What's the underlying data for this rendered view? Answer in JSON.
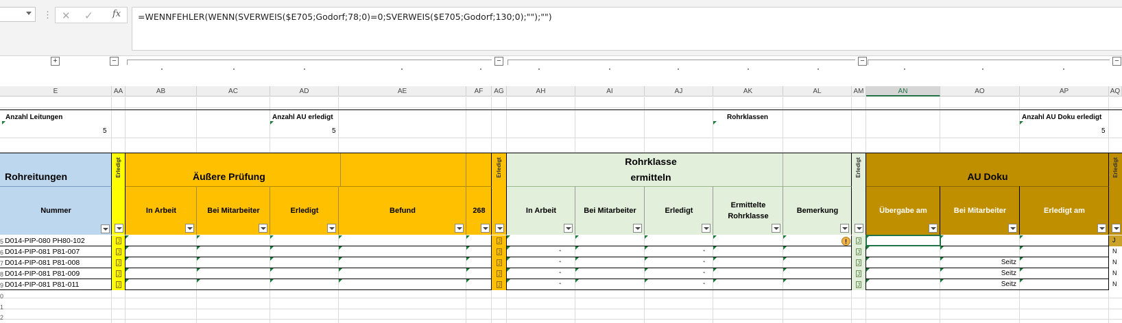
{
  "formula_bar": {
    "name_box": "",
    "cancel_icon": "x-icon",
    "enter_icon": "check-icon",
    "fx_label": "fx",
    "formula": "=WENNFEHLER(WENN(SVERWEIS($E705;Godorf;78;0)=0;SVERWEIS($E705;Godorf;130;0);\"\");\"\")"
  },
  "outline": {
    "expand_symbol": "+",
    "collapse_symbol": "−"
  },
  "columns": [
    "E",
    "AA",
    "AB",
    "AC",
    "AD",
    "AE",
    "AF",
    "AG",
    "AH",
    "AI",
    "AJ",
    "AK",
    "AL",
    "AM",
    "AN",
    "AO",
    "AP",
    "AQ"
  ],
  "selected_column": "AN",
  "summary": {
    "anzahl_leitungen_label": "Anzahl Leitungen",
    "anzahl_leitungen_value": "5",
    "anzahl_au_erledigt_label": "Anzahl AU erledigt",
    "anzahl_au_erledigt_value": "5",
    "rohrklassen_label": "Rohrklassen",
    "anzahl_au_doku_label": "Anzahl AU Doku erledigt",
    "anzahl_au_doku_value": "5"
  },
  "groups": {
    "rohrleitungen": "Rohreitungen",
    "aeussere_pruefung": "Äußere Prüfung",
    "rohrklasse_line1": "Rohrklasse",
    "rohrklasse_line2": "ermitteln",
    "au_doku": "AU Doku",
    "erledigt_vertical": "Erledigt"
  },
  "headers": {
    "nummer": "Nummer",
    "ab": "In Arbeit",
    "ac": "Bei Mitarbeiter",
    "ad": "Erledigt",
    "ae": "Befund",
    "af": "268",
    "ah": "In Arbeit",
    "ai": "Bei Mitarbeiter",
    "aj": "Erledigt",
    "ak_line1": "Ermittelte",
    "ak_line2": "Rohrklasse",
    "al": "Bemerkung",
    "an": "Übergabe am",
    "ao": "Bei Mitarbeiter",
    "ap": "Erledigt am"
  },
  "rows": [
    {
      "nummer": "D014-PIP-080 PH80-102",
      "aa": "J",
      "ag": "J",
      "ah": "",
      "aj": "",
      "am": "J",
      "ao": "",
      "aq": "J"
    },
    {
      "nummer": "D014-PIP-081 P81-007",
      "aa": "J",
      "ag": "J",
      "ah": "-",
      "aj": "-",
      "am": "J",
      "ao": "",
      "aq": "N"
    },
    {
      "nummer": "D014-PIP-081 P81-008",
      "aa": "J",
      "ag": "J",
      "ah": "-",
      "aj": "-",
      "am": "J",
      "ao": "Seitz",
      "aq": "N"
    },
    {
      "nummer": "D014-PIP-081 P81-009",
      "aa": "J",
      "ag": "J",
      "ah": "-",
      "aj": "-",
      "am": "J",
      "ao": "Seitz",
      "aq": "N"
    },
    {
      "nummer": "D014-PIP-081 P81-011",
      "aa": "J",
      "ag": "J",
      "ah": "-",
      "aj": "-",
      "am": "J",
      "ao": "Seitz",
      "aq": "N"
    }
  ],
  "row_numbers": [
    "5",
    "6",
    "7",
    "8",
    "9",
    "0",
    "1",
    "2"
  ],
  "colors": {
    "blue_header": "#bdd7ee",
    "orange": "#ffc000",
    "yellow": "#ffff00",
    "light_green": "#e2efda",
    "dark_gold": "#bf8f00",
    "tan": "#c9a227"
  },
  "warning_icon": "warning-circle-icon"
}
